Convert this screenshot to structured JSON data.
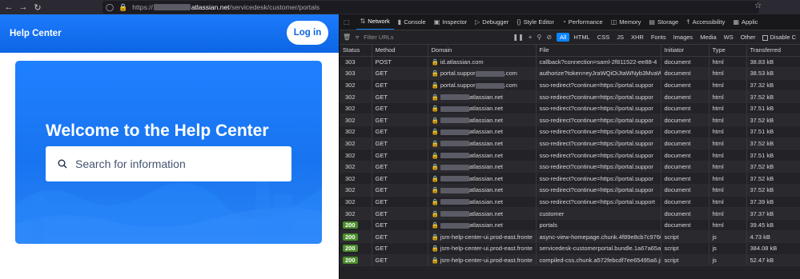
{
  "browser": {
    "url_scheme": "https://",
    "url_domain": "atlassian.net",
    "url_path": "/servicedesk/customer/portals",
    "back_icon": "arrow-left-icon",
    "forward_icon": "arrow-right-icon",
    "reload_icon": "reload-icon"
  },
  "portal": {
    "header_title": "Help Center",
    "login_label": "Log in",
    "hero_title": "Welcome to the Help Center",
    "search_placeholder": "Search for information",
    "brand_color": "#0c66e4"
  },
  "devtools": {
    "tabs": [
      {
        "label": "Network",
        "icon": "network-icon",
        "active": true
      },
      {
        "label": "Console",
        "icon": "console-icon"
      },
      {
        "label": "Inspector",
        "icon": "inspector-icon"
      },
      {
        "label": "Debugger",
        "icon": "debugger-icon"
      },
      {
        "label": "Style Editor",
        "icon": "style-editor-icon"
      },
      {
        "label": "Performance",
        "icon": "performance-icon"
      },
      {
        "label": "Memory",
        "icon": "memory-icon"
      },
      {
        "label": "Storage",
        "icon": "storage-icon"
      },
      {
        "label": "Accessibility",
        "icon": "accessibility-icon"
      },
      {
        "label": "Applic",
        "icon": "application-icon"
      }
    ],
    "filter_placeholder": "Filter URLs",
    "filter_types": [
      "All",
      "HTML",
      "CSS",
      "JS",
      "XHR",
      "Fonts",
      "Images",
      "Media",
      "WS",
      "Other"
    ],
    "disable_cache_label": "Disable C",
    "columns": [
      "Status",
      "Method",
      "Domain",
      "File",
      "Initiator",
      "Type",
      "Transferred"
    ],
    "rows": [
      {
        "status": "303",
        "method": "POST",
        "domain": "id.atlassian.com",
        "file": "callback?connection=saml-2f811522-ee88-4",
        "initiator": "document",
        "type": "html",
        "transferred": "38.83 kB"
      },
      {
        "status": "303",
        "method": "GET",
        "domain": "portal.suppor",
        "domain_suffix": ".com",
        "file": "authorize?token=eyJraWQiOiJtaWNyb3MvaW",
        "initiator": "document",
        "type": "html",
        "transferred": "38.53 kB"
      },
      {
        "status": "302",
        "method": "GET",
        "domain": "portal.suppor",
        "domain_suffix": ".com",
        "file": "sso-redirect?continue=https://portal.suppor",
        "initiator": "document",
        "type": "html",
        "transferred": "37.32 kB"
      },
      {
        "status": "302",
        "method": "GET",
        "domain": "atlassian.net",
        "file": "sso-redirect?continue=https://portal.suppor",
        "initiator": "document",
        "type": "html",
        "transferred": "37.52 kB"
      },
      {
        "status": "302",
        "method": "GET",
        "domain": "atlassian.net",
        "file": "sso-redirect?continue=https://portal.suppor",
        "initiator": "document",
        "type": "html",
        "transferred": "37.51 kB"
      },
      {
        "status": "302",
        "method": "GET",
        "domain": "atlassian.net",
        "file": "sso-redirect?continue=https://portal.suppor",
        "initiator": "document",
        "type": "html",
        "transferred": "37.52 kB"
      },
      {
        "status": "302",
        "method": "GET",
        "domain": "atlassian.net",
        "file": "sso-redirect?continue=https://portal.suppor",
        "initiator": "document",
        "type": "html",
        "transferred": "37.51 kB"
      },
      {
        "status": "302",
        "method": "GET",
        "domain": "atlassian.net",
        "file": "sso-redirect?continue=https://portal.suppor",
        "initiator": "document",
        "type": "html",
        "transferred": "37.52 kB"
      },
      {
        "status": "302",
        "method": "GET",
        "domain": "atlassian.net",
        "file": "sso-redirect?continue=https://portal.suppor",
        "initiator": "document",
        "type": "html",
        "transferred": "37.51 kB"
      },
      {
        "status": "302",
        "method": "GET",
        "domain": "atlassian.net",
        "file": "sso-redirect?continue=https://portal.suppor",
        "initiator": "document",
        "type": "html",
        "transferred": "37.52 kB"
      },
      {
        "status": "302",
        "method": "GET",
        "domain": "atlassian.net",
        "file": "sso-redirect?continue=https://portal.suppor",
        "initiator": "document",
        "type": "html",
        "transferred": "37.52 kB"
      },
      {
        "status": "302",
        "method": "GET",
        "domain": "atlassian.net",
        "file": "sso-redirect?continue=https://portal.suppor",
        "initiator": "document",
        "type": "html",
        "transferred": "37.52 kB"
      },
      {
        "status": "302",
        "method": "GET",
        "domain": "atlassian.net",
        "file": "sso-redirect?continue=https://portal.support",
        "initiator": "document",
        "type": "html",
        "transferred": "37.39 kB"
      },
      {
        "status": "302",
        "method": "GET",
        "domain": "atlassian.net",
        "file": "customer",
        "initiator": "document",
        "type": "html",
        "transferred": "37.37 kB"
      },
      {
        "status": "200",
        "method": "GET",
        "domain": "atlassian.net",
        "file": "portals",
        "initiator": "document",
        "type": "html",
        "transferred": "39.45 kB"
      },
      {
        "status": "200",
        "method": "GET",
        "domain": "jsm-help-center-ui.prod-east.fronte",
        "file": "async-view-homepage.chunk.4f89e8cb7c9760f31c",
        "initiator": "script",
        "type": "js",
        "transferred": "4.73 kB"
      },
      {
        "status": "200",
        "method": "GET",
        "domain": "jsm-help-center-ui.prod-east.fronte",
        "file": "servicedesk-customerportal.bundle.1a67a65a3775",
        "initiator": "script",
        "type": "js",
        "transferred": "384.08 kB"
      },
      {
        "status": "200",
        "method": "GET",
        "domain": "jsm-help-center-ui.prod-east.fronte",
        "file": "compiled-css.chunk.a572febcdf7ee65495a6.js",
        "initiator": "script",
        "type": "js",
        "transferred": "52.47 kB"
      }
    ]
  }
}
